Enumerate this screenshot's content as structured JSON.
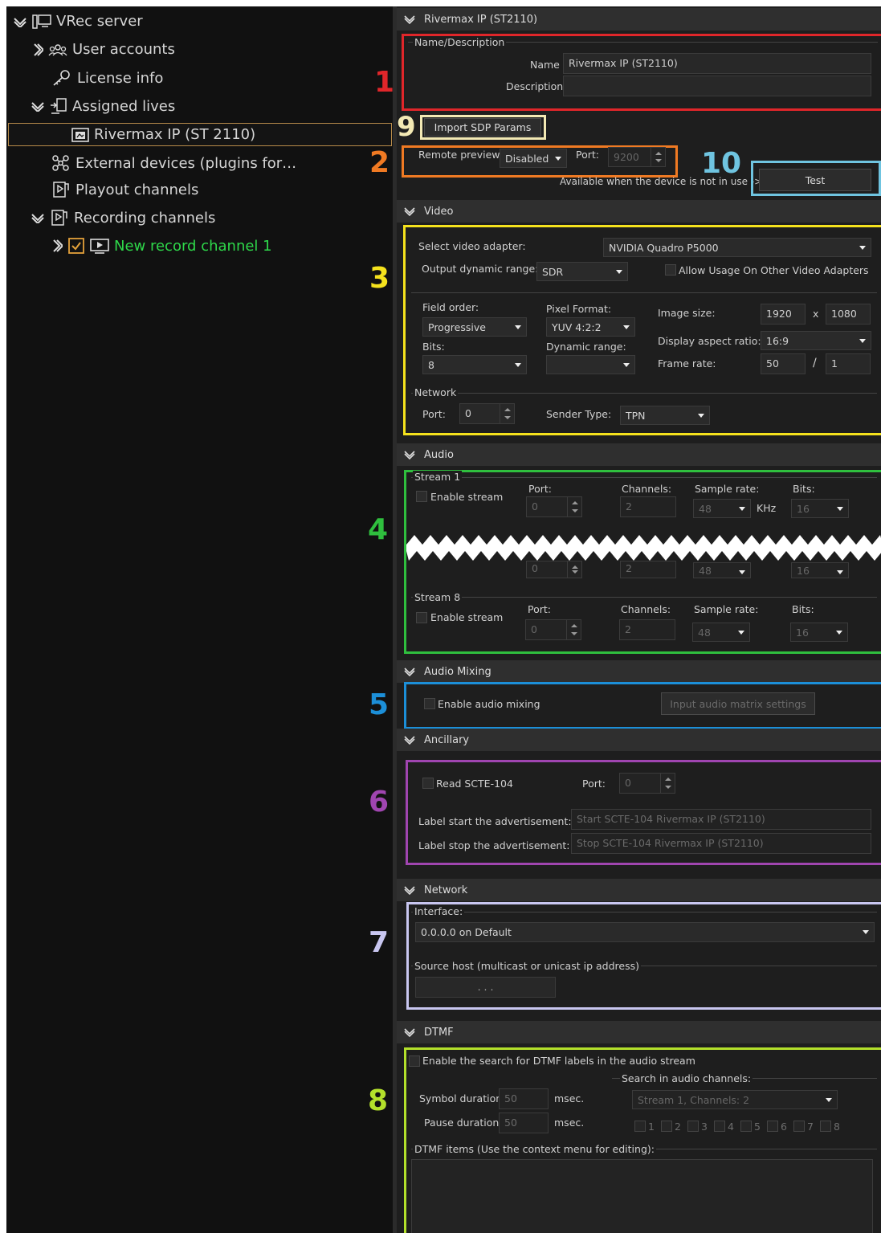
{
  "tree": {
    "server": "VRec server",
    "user_accounts": "User accounts",
    "license_info": "License info",
    "assigned_lives": "Assigned lives",
    "rivermax": "Rivermax  IP (ST 2110)",
    "external_devices": "External devices (plugins for…",
    "playout_channels": "Playout channels",
    "recording_channels": "Recording channels",
    "new_record_channel": "New record channel 1"
  },
  "header": {
    "title": "Rivermax IP (ST2110)"
  },
  "name_desc": {
    "group": "Name/Description",
    "name_label": "Name",
    "name_value": "Rivermax IP (ST2110)",
    "desc_label": "Description",
    "desc_value": ""
  },
  "import_sdp": "Import SDP Params",
  "remote_preview": {
    "label": "Remote preview:",
    "value": "Disabled",
    "port_label": "Port:",
    "port_value": "9200",
    "note": "Available when the device is not in use ->",
    "test": "Test"
  },
  "video": {
    "section": "Video",
    "adapter_label": "Select video adapter:",
    "adapter_value": "NVIDIA Quadro P5000",
    "odr_label": "Output dynamic range:",
    "odr_value": "SDR",
    "allow_usage": "Allow Usage On Other Video Adapters",
    "field_order_label": "Field order:",
    "field_order_value": "Progressive",
    "pixel_format_label": "Pixel Format:",
    "pixel_format_value": "YUV 4:2:2",
    "image_size_label": "Image size:",
    "width": "1920",
    "x": "x",
    "height": "1080",
    "bits_label": "Bits:",
    "bits_value": "8",
    "dyn_range_label": "Dynamic range:",
    "dyn_range_value": "",
    "dar_label": "Display aspect ratio:",
    "dar_value": "16:9",
    "frame_rate_label": "Frame rate:",
    "fr_num": "50",
    "slash": "/",
    "fr_den": "1",
    "network_group": "Network",
    "port_label": "Port:",
    "port_value": "0",
    "sender_type_label": "Sender Type:",
    "sender_type_value": "TPN"
  },
  "audio": {
    "section": "Audio",
    "stream1": "Stream 1",
    "stream8": "Stream 8",
    "enable_stream": "Enable stream",
    "port_label": "Port:",
    "channels_label": "Channels:",
    "sample_rate_label": "Sample rate:",
    "bits_label": "Bits:",
    "port_value": "0",
    "channels_value": "2",
    "sample_rate_value": "48",
    "khz": "KHz",
    "bits_value": "16"
  },
  "audio_mixing": {
    "section": "Audio Mixing",
    "enable": "Enable audio mixing",
    "matrix_button": "Input audio matrix settings"
  },
  "ancillary": {
    "section": "Ancillary",
    "read_scte": "Read SCTE-104",
    "port_label": "Port:",
    "port_value": "0",
    "start_label": "Label start the advertisement:",
    "start_value": "Start SCTE-104 Rivermax IP (ST2110)",
    "stop_label": "Label stop the advertisement:",
    "stop_value": "Stop SCTE-104 Rivermax IP (ST2110)"
  },
  "network": {
    "section": "Network",
    "interface_label": "Interface:",
    "interface_value": "0.0.0.0 on Default",
    "source_host_label": "Source host (multicast or unicast ip address)",
    "source_host_value": ".   .   ."
  },
  "dtmf": {
    "section": "DTMF",
    "enable": "Enable the search for DTMF labels in the audio stream",
    "search_group": "Search in audio channels:",
    "search_value": "Stream 1, Channels: 2",
    "symbol_label": "Symbol duration:",
    "symbol_value": "50",
    "pause_label": "Pause duration:",
    "pause_value": "50",
    "msec": "msec.",
    "channels": [
      "1",
      "2",
      "3",
      "4",
      "5",
      "6",
      "7",
      "8"
    ],
    "items_label": "DTMF items (Use the context menu for editing):"
  },
  "annotations": [
    "1",
    "2",
    "3",
    "4",
    "5",
    "6",
    "7",
    "8",
    "9",
    "10"
  ],
  "colors": {
    "box1": "#e0262a",
    "box2": "#f07a23",
    "box3": "#f5e21d",
    "box4": "#2fbf3e",
    "box5": "#1c8fd8",
    "box6": "#a045b0",
    "box7": "#c8c6f0",
    "box8": "#b3e02b",
    "box9": "#f3e9b4",
    "box10": "#6fc4e0"
  }
}
